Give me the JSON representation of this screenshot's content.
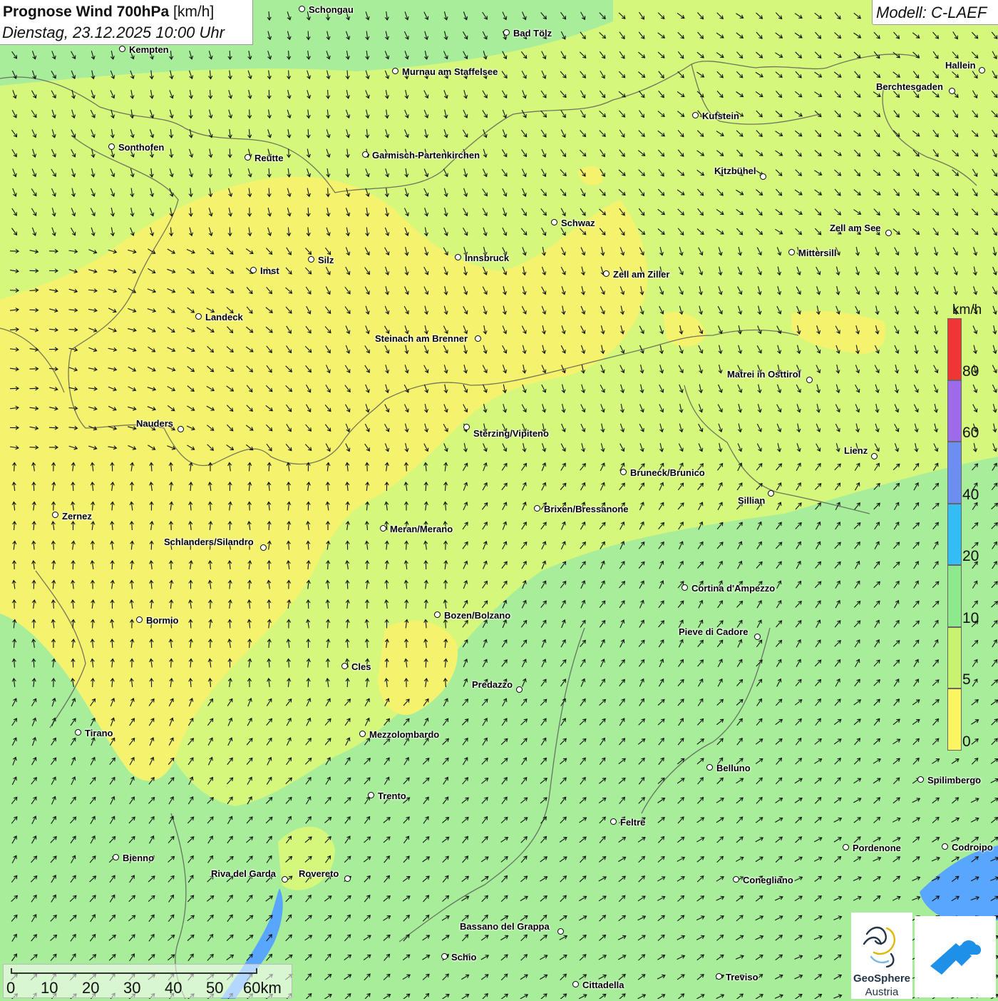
{
  "header": {
    "title_bold": "Prognose Wind 700hPa",
    "title_unit": "[km/h]",
    "datetime": "Dienstag, 23.12.2025 10:00 Uhr"
  },
  "model": {
    "label": "Modell: C-LAEF"
  },
  "legend": {
    "unit": "km/h",
    "ticks": [
      "0",
      "5",
      "10",
      "20",
      "40",
      "60",
      "80"
    ],
    "colors": [
      "#fbf562",
      "#c9f36e",
      "#8ee98c",
      "#33bdf4",
      "#6b8ef0",
      "#9d6be9",
      "#f03535"
    ]
  },
  "scale_bar": {
    "labels": [
      "0",
      "10",
      "20",
      "30",
      "40",
      "50",
      "60km"
    ]
  },
  "logos": {
    "geosphere_line1": "GeoSphere",
    "geosphere_line2": "Austria"
  },
  "map_colors": {
    "zone_green": "#a8ee9a",
    "zone_lime": "#d4f77c",
    "zone_yellow": "#f5f36e",
    "water": "#58a6ff",
    "border": "#555555"
  },
  "cities": [
    {
      "name": "Schongau"
    },
    {
      "name": "Bad Tölz"
    },
    {
      "name": "Kempten"
    },
    {
      "name": "Murnau am Staffelsee"
    },
    {
      "name": "Hallein"
    },
    {
      "name": "Berchtesgaden"
    },
    {
      "name": "Kufstein"
    },
    {
      "name": "Sonthofen"
    },
    {
      "name": "Reutte"
    },
    {
      "name": "Garmisch-Partenkirchen"
    },
    {
      "name": "Kitzbühel"
    },
    {
      "name": "Schwaz"
    },
    {
      "name": "Zell am See"
    },
    {
      "name": "Silz"
    },
    {
      "name": "Innsbruck"
    },
    {
      "name": "Mittersill"
    },
    {
      "name": "Imst"
    },
    {
      "name": "Zell am Ziller"
    },
    {
      "name": "Landeck"
    },
    {
      "name": "Steinach am Brenner"
    },
    {
      "name": "Matrei in Osttirol"
    },
    {
      "name": "Nauders"
    },
    {
      "name": "Sterzing/Vipiteno"
    },
    {
      "name": "Lienz"
    },
    {
      "name": "Bruneck/Brunico"
    },
    {
      "name": "Sillian"
    },
    {
      "name": "Zernez"
    },
    {
      "name": "Brixen/Bressanone"
    },
    {
      "name": "Meran/Merano"
    },
    {
      "name": "Schlanders/Silandro"
    },
    {
      "name": "Cortina d'Ampezzo"
    },
    {
      "name": "Bormio"
    },
    {
      "name": "Bozen/Bolzano"
    },
    {
      "name": "Pieve di Cadore"
    },
    {
      "name": "Cles"
    },
    {
      "name": "Predazzo"
    },
    {
      "name": "Tirano"
    },
    {
      "name": "Mezzolombardo"
    },
    {
      "name": "Belluno"
    },
    {
      "name": "Spilimbergo"
    },
    {
      "name": "Trento"
    },
    {
      "name": "Feltre"
    },
    {
      "name": "Pordenone"
    },
    {
      "name": "Codroipo"
    },
    {
      "name": "Bienno"
    },
    {
      "name": "Riva del Garda"
    },
    {
      "name": "Rovereto"
    },
    {
      "name": "Conegliano"
    },
    {
      "name": "Bassano del Grappa"
    },
    {
      "name": "Schio"
    },
    {
      "name": "Treviso"
    },
    {
      "name": "Cittadella"
    }
  ]
}
